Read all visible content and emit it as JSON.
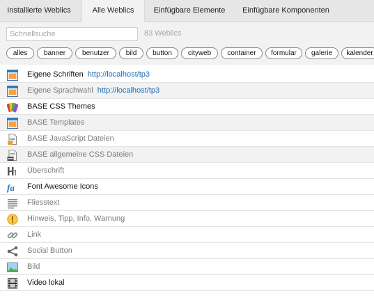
{
  "tabs": [
    {
      "label": "Installierte Weblics"
    },
    {
      "label": "Alle Weblics"
    },
    {
      "label": "Einfügbare Elemente"
    },
    {
      "label": "Einfügbare Komponenten"
    }
  ],
  "active_tab": "Alle Weblics",
  "search": {
    "placeholder": "Schnellsuche",
    "value": ""
  },
  "count_text": "83 Weblics",
  "filters": [
    "alles",
    "banner",
    "benutzer",
    "bild",
    "button",
    "cityweb",
    "container",
    "formular",
    "galerie",
    "kalender"
  ],
  "items": [
    {
      "label": "Eigene Schriften",
      "url": "http://localhost/tp3",
      "icon": "window-icon",
      "muted": false
    },
    {
      "label": "Eigene Sprachwahl",
      "url": "http://localhost/tp3",
      "icon": "window-icon",
      "muted": true
    },
    {
      "label": "BASE CSS Themes",
      "icon": "color-swatches-icon",
      "muted": false
    },
    {
      "label": "BASE Templates",
      "icon": "window-icon",
      "muted": true
    },
    {
      "label": "BASE JavaScript Dateien",
      "icon": "js-file-icon",
      "muted": true
    },
    {
      "label": "BASE allgemeine CSS Dateien",
      "icon": "css-file-icon",
      "muted": true
    },
    {
      "label": "Überschrift",
      "icon": "heading-icon",
      "muted": true
    },
    {
      "label": "Font Awesome Icons",
      "icon": "font-awesome-icon",
      "muted": false
    },
    {
      "label": "Fliesstext",
      "icon": "paragraph-icon",
      "muted": true
    },
    {
      "label": "Hinweis, Tipp, Info, Warnung",
      "icon": "warning-icon",
      "muted": true
    },
    {
      "label": "Link",
      "icon": "link-icon",
      "muted": true
    },
    {
      "label": "Social Button",
      "icon": "share-icon",
      "muted": true
    },
    {
      "label": "Bild",
      "icon": "image-icon",
      "muted": true
    },
    {
      "label": "Video lokal",
      "icon": "film-icon",
      "muted": false
    }
  ],
  "colors": {
    "link": "#1a6bb8",
    "muted_text": "#7a7a7a",
    "tab_bar": "#e6e6e6",
    "toolbar": "#f2f2f2"
  }
}
